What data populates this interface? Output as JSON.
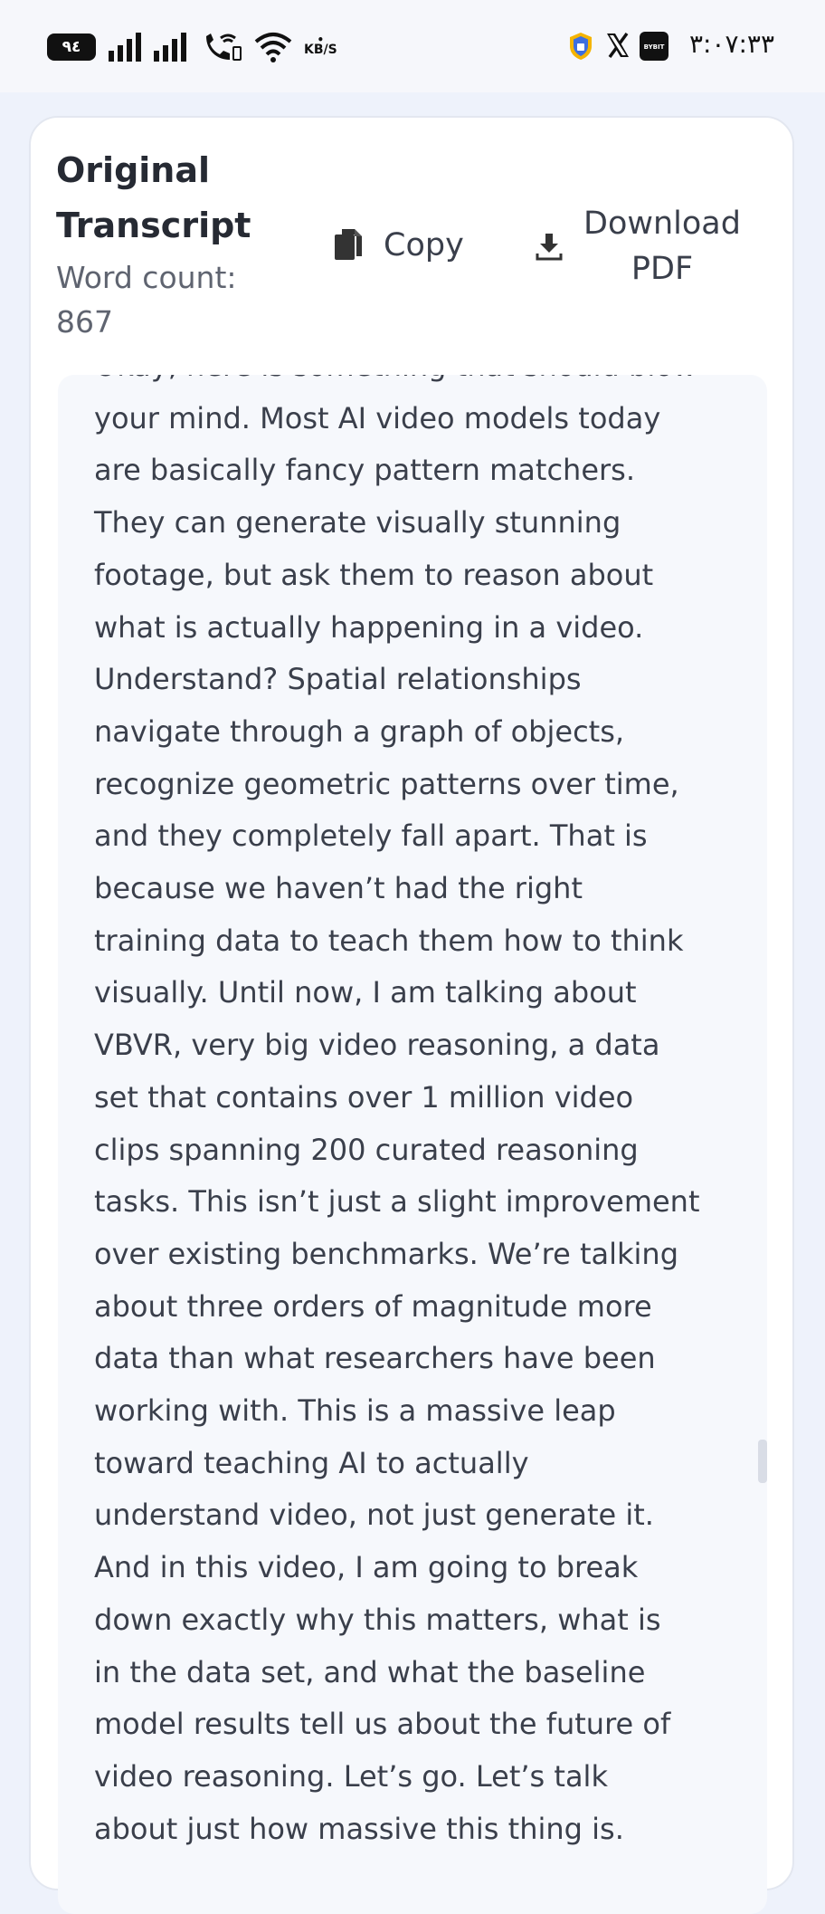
{
  "status_bar": {
    "battery": "٩٤",
    "speed_unit": "KB/S",
    "time": "٣:٠٧:٣٣",
    "icons": [
      "battery-icon",
      "signal-icon",
      "signal-icon",
      "wifi-call-icon",
      "wifi-icon",
      "vpn-shield-icon",
      "x-app-icon",
      "bybit-app-icon"
    ]
  },
  "header": {
    "title": "Original Transcript",
    "word_count_label": "Word count: 867",
    "copy_label": "Copy",
    "download_label": "Download PDF"
  },
  "transcript": {
    "lines": [
      "Okay, here is something that should blow",
      "your mind. Most AI video models today",
      "are basically fancy pattern matchers.",
      "They can generate visually stunning",
      "footage, but ask them to reason about",
      "what is actually happening in a video.",
      "Understand? Spatial relationships",
      "navigate through a graph of objects,",
      "recognize geometric patterns over time,",
      "and they completely fall apart. That is",
      "because we haven’t had the right",
      "training data to teach them how to think",
      "visually. Until now, I am talking about",
      "VBVR, very big video reasoning, a data",
      "set that contains over 1 million video",
      "clips spanning 200 curated reasoning",
      "tasks. This isn’t just a slight improvement",
      "over existing benchmarks. We’re talking",
      "about three orders of magnitude more",
      "data than what researchers have been",
      "working with. This is a massive leap",
      "toward teaching AI to actually",
      "understand video, not just generate it.",
      "And in this video, I am going to break",
      "down exactly why this matters, what is",
      "in the data set, and what the baseline",
      "model results tell us about the future of",
      "video reasoning. Let’s go. Let’s talk",
      "about just how massive this thing is."
    ]
  }
}
